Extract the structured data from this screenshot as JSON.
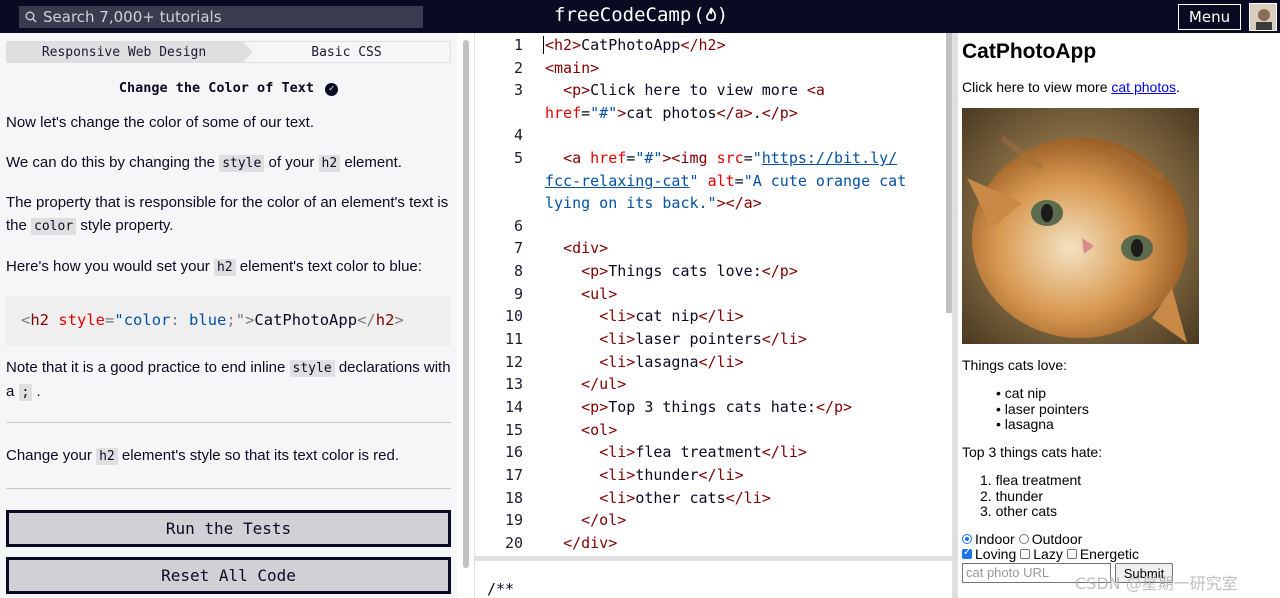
{
  "header": {
    "search_placeholder": "Search 7,000+ tutorials",
    "brand": "freeCodeCamp",
    "brand_icon": "flame-icon",
    "menu_label": "Menu"
  },
  "breadcrumb": {
    "superblock": "Responsive Web Design",
    "block": "Basic CSS"
  },
  "challenge": {
    "title": "Change the Color of Text",
    "p1": "Now let's change the color of some of our text.",
    "p2_a": "We can do this by changing the ",
    "p2_code1": "style",
    "p2_b": " of your ",
    "p2_code2": "h2",
    "p2_c": " element.",
    "p3_a": "The property that is responsible for the color of an element's text is the ",
    "p3_code": "color",
    "p3_b": " style property.",
    "p4_a": "Here's how you would set your ",
    "p4_code": "h2",
    "p4_b": " element's text color to blue:",
    "example": {
      "open": "<h2",
      "attr": "style",
      "eq": "=",
      "val1": "\"color",
      "colon": ":",
      "val2": " blue",
      "semi": ";\"",
      "close": ">",
      "text": "CatPhotoApp",
      "end": "</h2>"
    },
    "p5_a": "Note that it is a good practice to end inline ",
    "p5_code": "style",
    "p5_b": " declarations with a ",
    "p5_code2": ";",
    "p5_c": " .",
    "p6_a": "Change your ",
    "p6_code": "h2",
    "p6_b": " element's style so that its text color is red.",
    "run_label": "Run the Tests",
    "reset_label": "Reset All Code"
  },
  "editor": {
    "line_numbers": [
      "1",
      "2",
      "3",
      "4",
      "5",
      "6",
      "7",
      "8",
      "9",
      "10",
      "11",
      "12",
      "13",
      "14",
      "15",
      "16",
      "17",
      "18",
      "19",
      "20"
    ],
    "console_text": "/**"
  },
  "preview": {
    "title": "CatPhotoApp",
    "intro": "Click here to view more ",
    "intro_link": "cat photos",
    "intro_end": ".",
    "love_heading": "Things cats love:",
    "love_items": [
      "cat nip",
      "laser pointers",
      "lasagna"
    ],
    "hate_heading": "Top 3 things cats hate:",
    "hate_items": [
      "1. flea treatment",
      "2. thunder",
      "3. other cats"
    ],
    "indoor": "Indoor",
    "outdoor": "Outdoor",
    "loving": "Loving",
    "lazy": "Lazy",
    "energetic": "Energetic",
    "url_placeholder": "cat photo URL",
    "submit": "Submit"
  },
  "watermark": "CSDN @星期一研究室"
}
